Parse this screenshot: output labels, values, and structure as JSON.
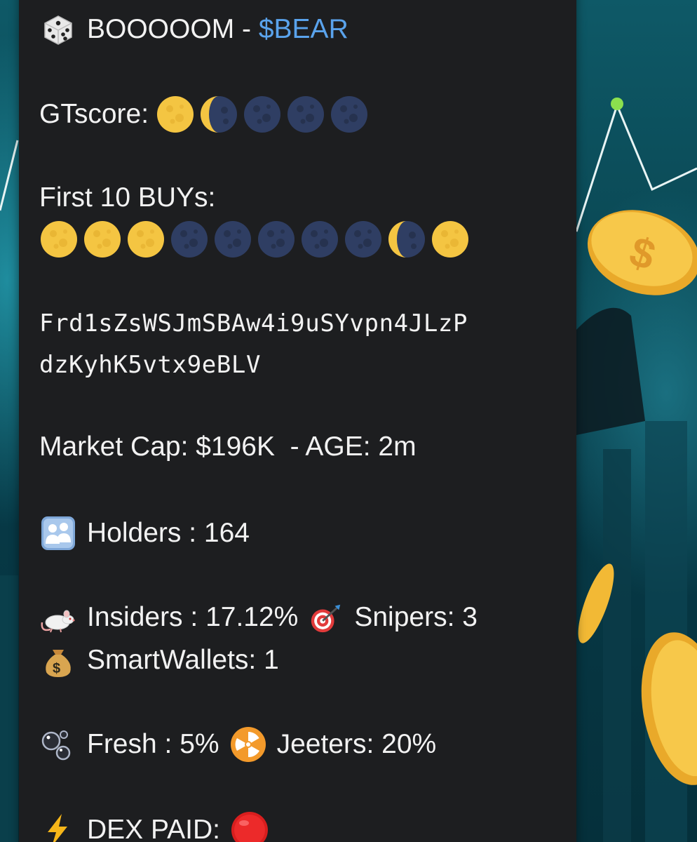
{
  "message": {
    "title_prefix": "BOOOOOM -",
    "ticker": "$BEAR",
    "gtscore_label": "GTscore:",
    "gtscore_moons": [
      "full",
      "half",
      "new",
      "new",
      "new"
    ],
    "first_buys_label": "First 10 BUYs:",
    "first_buys_moons": [
      "full",
      "full",
      "full",
      "new",
      "new",
      "new",
      "new",
      "new",
      "half",
      "full"
    ],
    "address_line1": "Frd1sZsWSJmSBAw4i9uSYvpn4JLzP",
    "address_line2": "dzKyhK5vtx9eBLV",
    "market_cap": "Market Cap: $196K  - AGE: 2m",
    "holders": "Holders : 164",
    "insiders": "Insiders : 17.12%",
    "snipers": "Snipers: 3",
    "smart_wallets": "SmartWallets: 1",
    "fresh": "Fresh : 5%",
    "jeeters": "Jeeters: 20%",
    "dex_paid": "DEX PAID:"
  },
  "icons": {
    "title": "dice-icon",
    "holders": "people-icon",
    "insiders": "rat-icon",
    "snipers": "dart-target-icon",
    "smart_wallets": "money-bag-icon",
    "fresh": "bubbles-icon",
    "jeeters": "radioactive-icon",
    "dex_paid": "lightning-icon",
    "dex_status": "red-circle-icon"
  },
  "colors": {
    "bubble_bg": "#1d1e20",
    "text": "#f2f2f2",
    "ticker": "#5aa3ec",
    "moon_full": "#f4c542",
    "moon_new": "#2f3e63"
  }
}
